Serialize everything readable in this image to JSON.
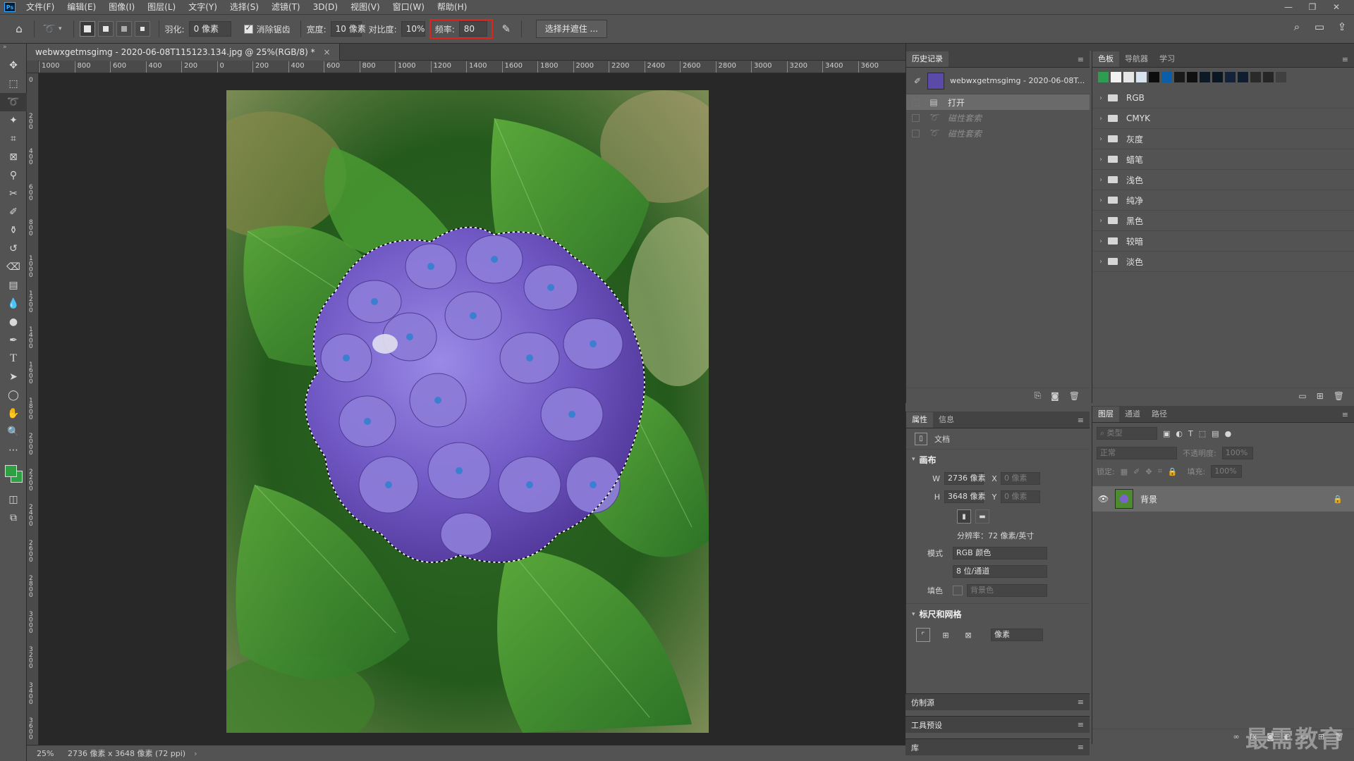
{
  "app": {
    "logo": "Ps",
    "menus": [
      "文件(F)",
      "编辑(E)",
      "图像(I)",
      "图层(L)",
      "文字(Y)",
      "选择(S)",
      "滤镜(T)",
      "3D(D)",
      "视图(V)",
      "窗口(W)",
      "帮助(H)"
    ],
    "window_buttons": [
      "—",
      "❐",
      "✕"
    ]
  },
  "options": {
    "feather_label": "羽化:",
    "feather_value": "0 像素",
    "antialias_label": "消除锯齿",
    "width_label": "宽度:",
    "width_value": "10 像素",
    "contrast_label": "对比度:",
    "contrast_value": "10%",
    "frequency_label": "频率:",
    "frequency_value": "80",
    "select_mask_label": "选择并遮住 ..."
  },
  "document": {
    "tab_title": "webwxgetmsgimg - 2020-06-08T115123.134.jpg @ 25%(RGB/8) *",
    "tab_close": "×",
    "ruler_h": [
      "1000",
      "800",
      "600",
      "400",
      "200",
      "0",
      "200",
      "400",
      "600",
      "800",
      "1000",
      "1200",
      "1400",
      "1600",
      "1800",
      "2000",
      "2200",
      "2400",
      "2600",
      "2800",
      "3000",
      "3200",
      "3400",
      "3600"
    ],
    "ruler_v": [
      "0",
      "2 0 0",
      "4 0 0",
      "6 0 0",
      "8 0 0",
      "1 0 0 0",
      "1 2 0 0",
      "1 4 0 0",
      "1 6 0 0",
      "1 8 0 0",
      "2 0 0 0",
      "2 2 0 0",
      "2 4 0 0",
      "2 6 0 0",
      "2 8 0 0",
      "3 0 0 0",
      "3 2 0 0",
      "3 4 0 0",
      "3 6 0 0"
    ],
    "zoom": "25%",
    "status": "2736 像素 x 3648 像素 (72 ppi)",
    "status_arrow": "›"
  },
  "history": {
    "tabs": [
      "历史记录"
    ],
    "snapshot_name": "webwxgetmsgimg - 2020-06-08T...",
    "rows": [
      {
        "label": "打开",
        "state": "selected"
      },
      {
        "label": "磁性套索",
        "state": "dim"
      },
      {
        "label": "磁性套索",
        "state": "dim"
      }
    ]
  },
  "swatches": {
    "tabs": [
      "色板",
      "导航器",
      "学习"
    ],
    "colors": [
      "#2e9d4f",
      "#f2f2f2",
      "#e6e6e6",
      "#d9e3f0",
      "#0d0d0d",
      "#0b5ea8",
      "#1a1a1a",
      "#101010",
      "#0d1a26",
      "#0a1622",
      "#14233a",
      "#0f1e2e",
      "#2a2a2a",
      "#262626",
      "#404040"
    ],
    "groups": [
      "RGB",
      "CMYK",
      "灰度",
      "蜡笔",
      "浅色",
      "纯净",
      "黑色",
      "较暗",
      "淡色"
    ]
  },
  "properties": {
    "tabs": [
      "属性",
      "信息"
    ],
    "doc_label": "文档",
    "canvas_title": "画布",
    "w_label": "W",
    "w_value": "2736 像素",
    "h_label": "H",
    "h_value": "3648 像素",
    "x_label": "X",
    "x_value": "0 像素",
    "y_label": "Y",
    "y_value": "0 像素",
    "resolution": "分辨率：72 像素/英寸",
    "mode_label": "模式",
    "mode_value": "RGB 颜色",
    "depth_value": "8 位/通道",
    "fill_label": "填色",
    "fill_value": "背景色",
    "rulers_title": "标尺和网格",
    "units_value": "像素"
  },
  "collapsed_panels": [
    "仿制源",
    "工具预设",
    "库"
  ],
  "layers": {
    "tabs": [
      "图层",
      "通道",
      "路径"
    ],
    "filter_placeholder": "类型",
    "blend_mode": "正常",
    "opacity_label": "不透明度:",
    "opacity_value": "100%",
    "lock_label": "锁定:",
    "fill_label": "填充:",
    "fill_value": "100%",
    "layer_name": "背景"
  },
  "watermark": "最需教育"
}
